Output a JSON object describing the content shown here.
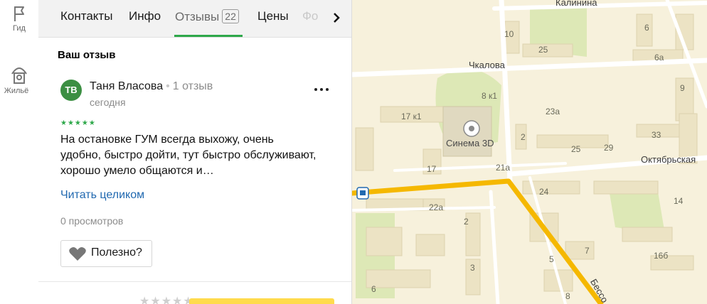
{
  "rail": {
    "items": [
      {
        "label": "Гид",
        "icon": "flag-icon"
      },
      {
        "label": "Жильё",
        "icon": "house-icon"
      }
    ]
  },
  "tabs": [
    {
      "label": "Контакты"
    },
    {
      "label": "Инфо"
    },
    {
      "label": "Отзывы",
      "count": "22",
      "active": true
    },
    {
      "label": "Цены"
    },
    {
      "label": "Фо"
    }
  ],
  "review": {
    "section_title": "Ваш отзыв",
    "avatar_initials": "ТВ",
    "author": "Таня Власова",
    "author_reviews": "1 отзыв",
    "date": "сегодня",
    "rating": 5,
    "stars": "★★★★★",
    "text": "На остановке ГУМ всегда выхожу, очень удобно, быстро дойти, тут быстро обслуживают, хорошо умело общаются и…",
    "read_more": "Читать целиком",
    "views": "0 просмотров",
    "useful_label": "Полезно?"
  },
  "rate_bar": {
    "stars": "★★★★★"
  },
  "map": {
    "streets": [
      "Калинина",
      "Чкалова",
      "Октябрьская",
      "Бессо"
    ],
    "buildings": [
      "10",
      "25",
      "6",
      "6а",
      "8 к1",
      "9",
      "17 к1",
      "23а",
      "2",
      "25",
      "29",
      "33",
      "17",
      "21а",
      "24",
      "22а",
      "2",
      "3",
      "14",
      "7",
      "16б",
      "5",
      "6",
      "8"
    ],
    "poi": "Синема 3D",
    "colors": {
      "main_road": "#f5b800",
      "background": "#f7f1dc",
      "block": "#ece3c4",
      "park": "#d8e6b0"
    }
  },
  "colors": {
    "accent_green": "#2ea84a",
    "link_blue": "#2169b0",
    "avatar_green": "#3c8f43"
  }
}
